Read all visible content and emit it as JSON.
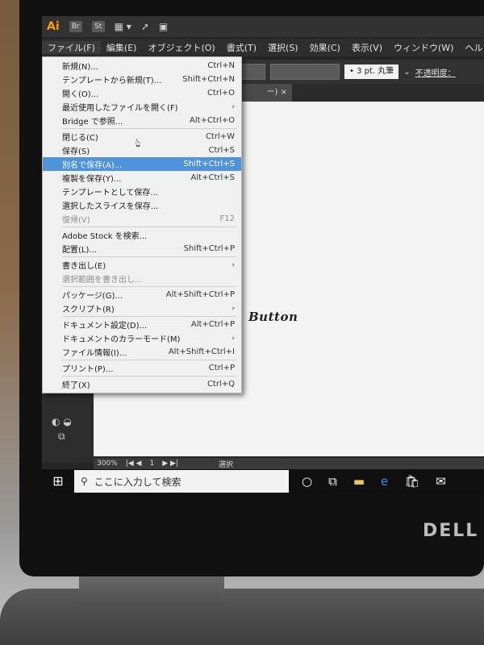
{
  "app": {
    "logo": "Ai",
    "bridge_btn": "Br",
    "stock_btn": "St"
  },
  "menubar": {
    "items": [
      {
        "label": "ファイル(F)"
      },
      {
        "label": "編集(E)"
      },
      {
        "label": "オブジェクト(O)"
      },
      {
        "label": "書式(T)"
      },
      {
        "label": "選択(S)"
      },
      {
        "label": "効果(C)"
      },
      {
        "label": "表示(V)"
      },
      {
        "label": "ウィンドウ(W)"
      },
      {
        "label": "ヘルプ(H)"
      }
    ]
  },
  "control": {
    "stroke": "3 pt. 丸筆",
    "opacity_label": "不透明度："
  },
  "document_tab": {
    "label": "ー)",
    "close": "×"
  },
  "file_menu": {
    "items": [
      {
        "label": "新規(N)...",
        "shortcut": "Ctrl+N"
      },
      {
        "label": "テンプレートから新規(T)...",
        "shortcut": "Shift+Ctrl+N"
      },
      {
        "label": "開く(O)...",
        "shortcut": "Ctrl+O"
      },
      {
        "label": "最近使用したファイルを開く(F)",
        "shortcut": "›"
      },
      {
        "label": "Bridge で参照...",
        "shortcut": "Alt+Ctrl+O"
      },
      {
        "label": "閉じる(C)",
        "shortcut": "Ctrl+W"
      },
      {
        "label": "保存(S)",
        "shortcut": "Ctrl+S"
      },
      {
        "label": "別名で保存(A)...",
        "shortcut": "Shift+Ctrl+S"
      },
      {
        "label": "複製を保存(Y)...",
        "shortcut": "Alt+Ctrl+S"
      },
      {
        "label": "テンプレートとして保存...",
        "shortcut": ""
      },
      {
        "label": "選択したスライスを保存...",
        "shortcut": ""
      },
      {
        "label": "復帰(V)",
        "shortcut": "F12"
      },
      {
        "label": "Adobe Stock を検索...",
        "shortcut": ""
      },
      {
        "label": "配置(L)...",
        "shortcut": "Shift+Ctrl+P"
      },
      {
        "label": "書き出し(E)",
        "shortcut": "›"
      },
      {
        "label": "選択範囲を書き出し...",
        "shortcut": ""
      },
      {
        "label": "パッケージ(G)...",
        "shortcut": "Alt+Shift+Ctrl+P"
      },
      {
        "label": "スクリプト(R)",
        "shortcut": "›"
      },
      {
        "label": "ドキュメント設定(D)...",
        "shortcut": "Alt+Ctrl+P"
      },
      {
        "label": "ドキュメントのカラーモード(M)",
        "shortcut": "›"
      },
      {
        "label": "ファイル情報(I)...",
        "shortcut": "Alt+Shift+Ctrl+I"
      },
      {
        "label": "プリント(P)...",
        "shortcut": "Ctrl+P"
      },
      {
        "label": "終了(X)",
        "shortcut": "Ctrl+Q"
      }
    ]
  },
  "canvas": {
    "text": "Button"
  },
  "status": {
    "zoom": "300%",
    "page": "1",
    "mode": "選択"
  },
  "taskbar": {
    "search_placeholder": "ここに入力して検索"
  },
  "hardware": {
    "brand": "DELL"
  }
}
